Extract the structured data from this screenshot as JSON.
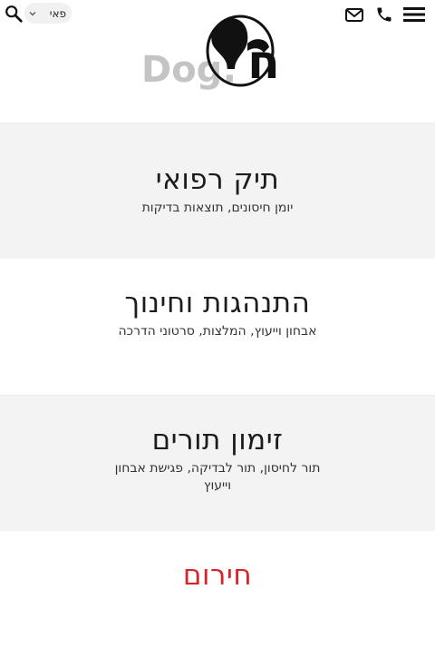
{
  "header": {
    "pet_selector": {
      "selected": "פאי"
    },
    "logo": {
      "text": "Dog:",
      "mark_letter": "ח"
    }
  },
  "cards": [
    {
      "title": "תיק רפואי",
      "subtitle": "יומן חיסונים, תוצאות בדיקות"
    },
    {
      "title": "התנהגות וחינוך",
      "subtitle": "אבחון וייעוץ, המלצות, סרטוני הדרכה"
    },
    {
      "title": "זימון תורים",
      "subtitle": "תור לחיסון, תור לבדיקה, פגישת אבחון וייעוץ"
    },
    {
      "title": "חירום",
      "subtitle": ""
    }
  ],
  "colors": {
    "emergency": "#d8232a",
    "card_gray": "#f3f3f3"
  },
  "icons": [
    "search-icon",
    "chevron-down-icon",
    "mail-icon",
    "phone-icon",
    "hamburger-menu-icon"
  ]
}
